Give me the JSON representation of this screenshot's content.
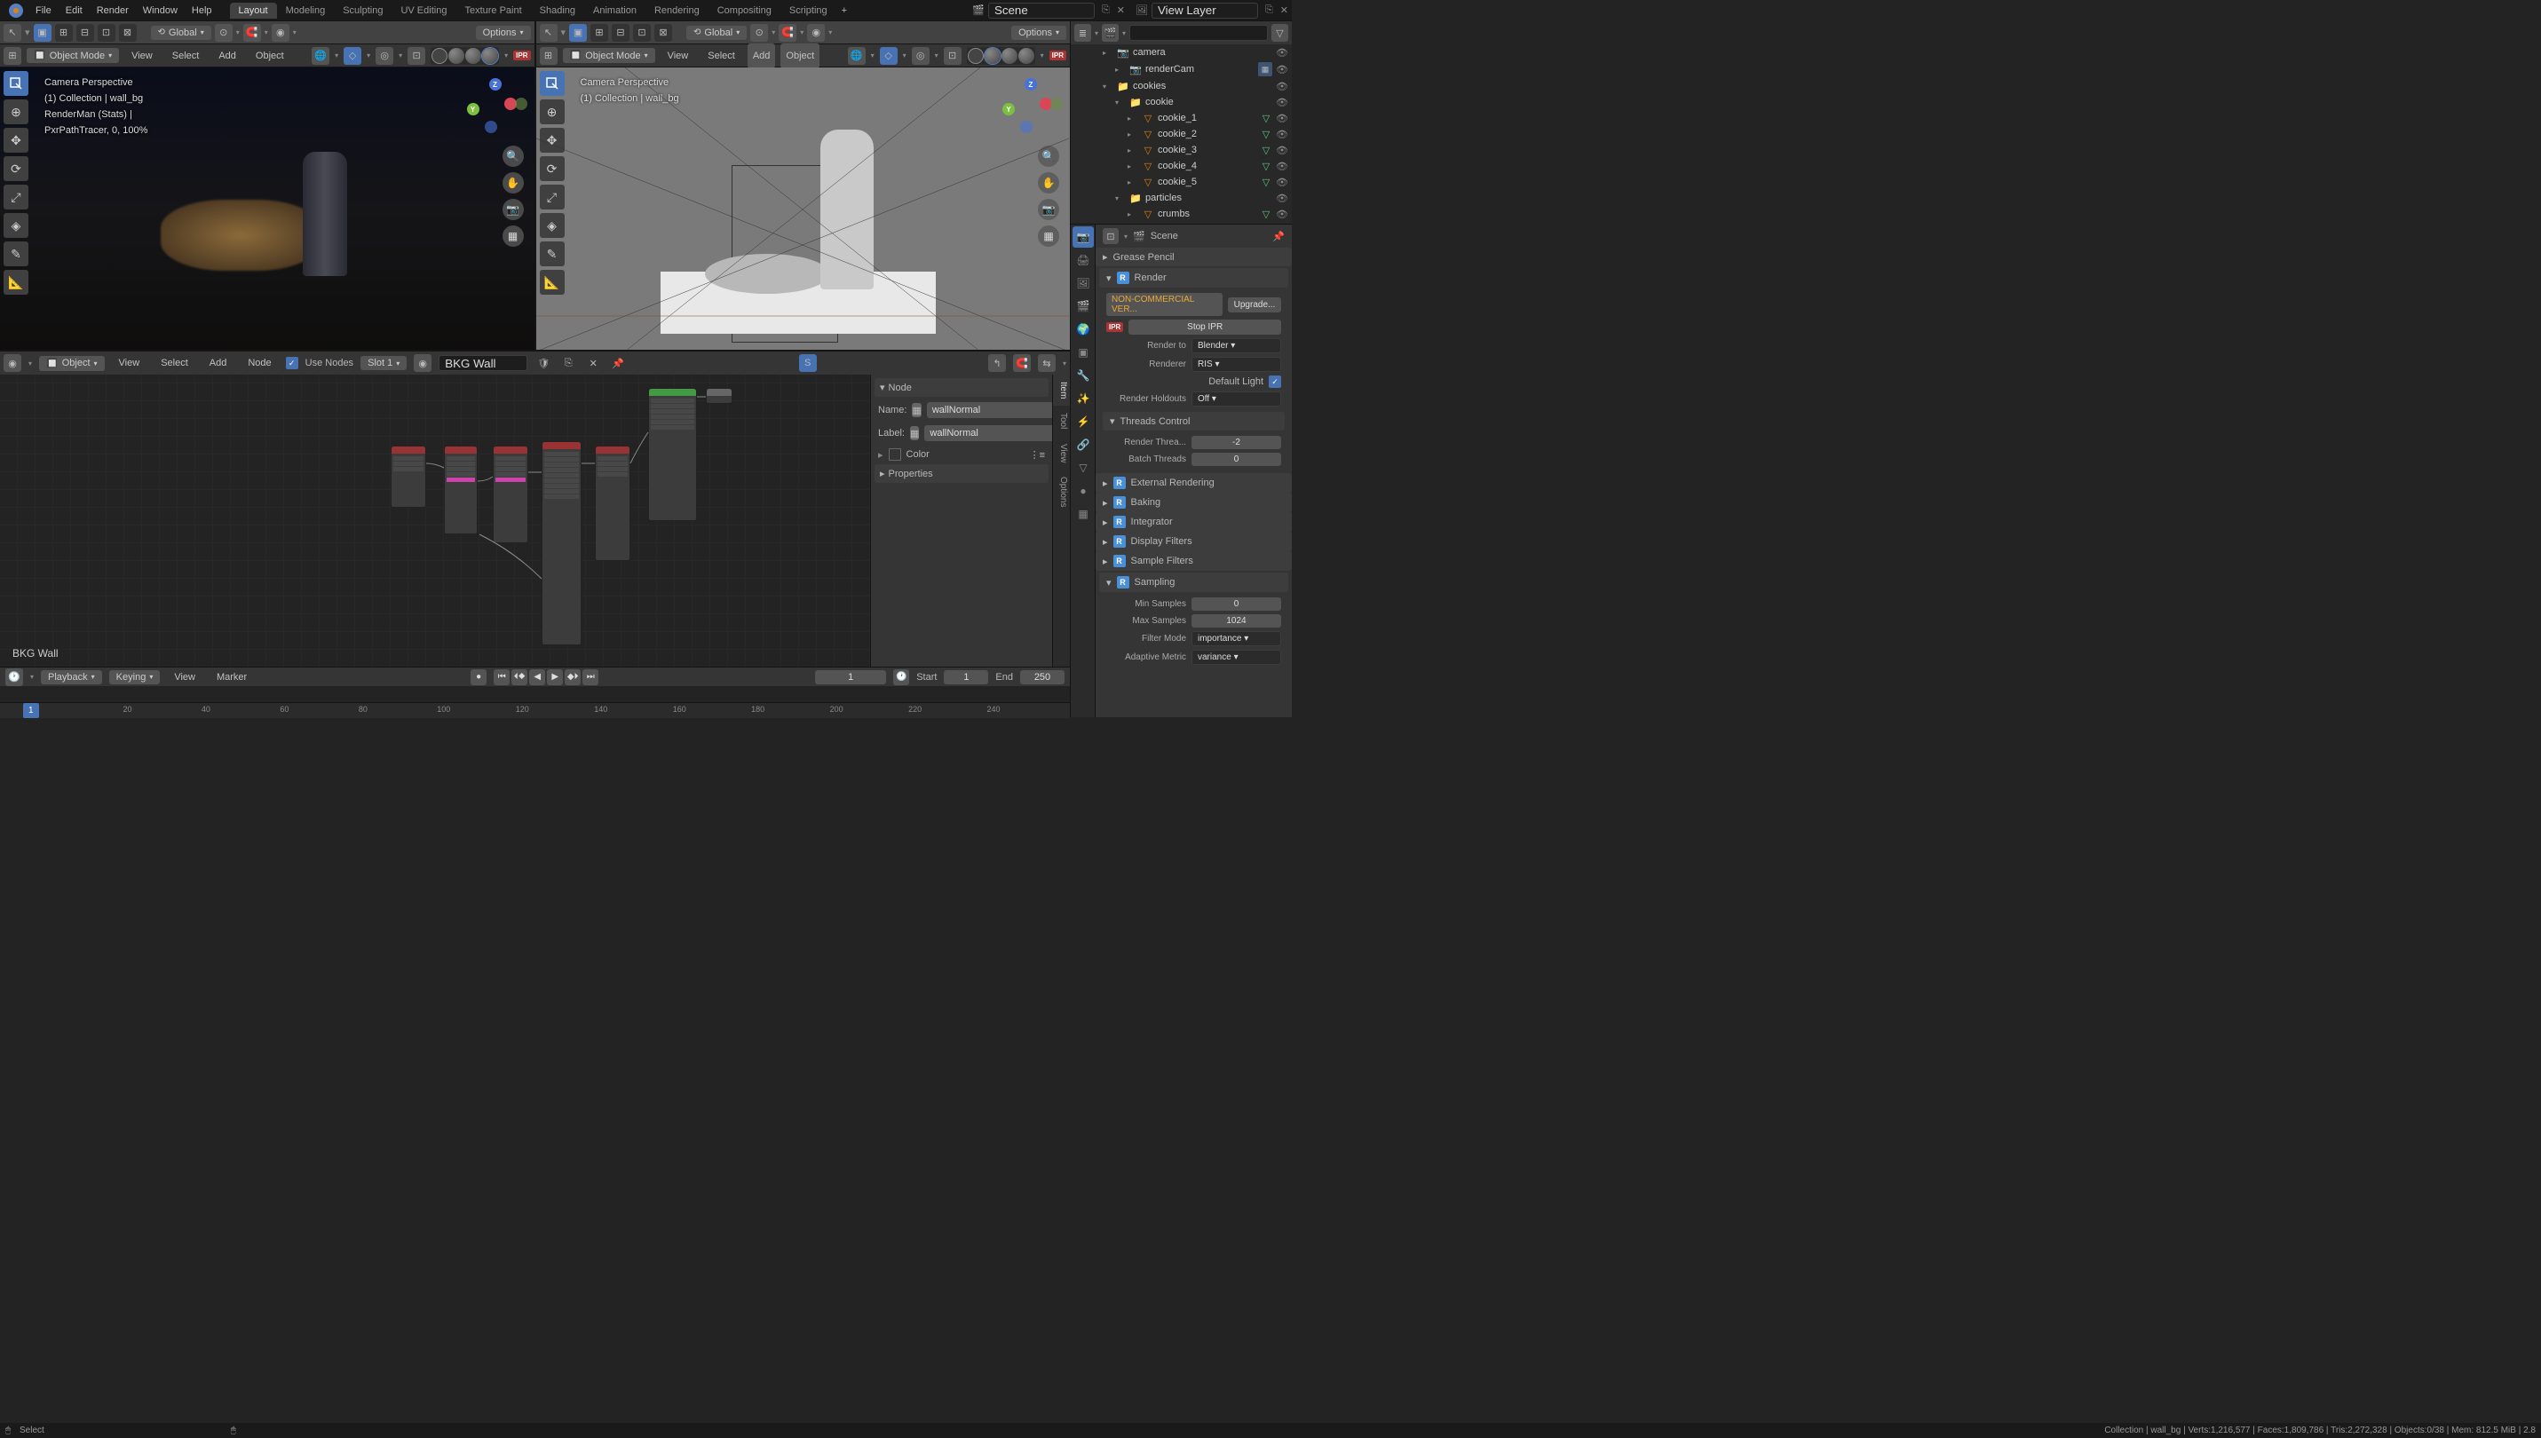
{
  "menu": {
    "file": "File",
    "edit": "Edit",
    "render": "Render",
    "window": "Window",
    "help": "Help"
  },
  "workspaces": [
    "Layout",
    "Modeling",
    "Sculpting",
    "UV Editing",
    "Texture Paint",
    "Shading",
    "Animation",
    "Rendering",
    "Compositing",
    "Scripting"
  ],
  "active_workspace": "Layout",
  "scene_name": "Scene",
  "view_layer": "View Layer",
  "viewport": {
    "header": {
      "orientation": "Global",
      "options_label": "Options"
    },
    "mode": "Object Mode",
    "menu_view": "View",
    "menu_select": "Select",
    "menu_add": "Add",
    "menu_object": "Object",
    "info_line1": "Camera Perspective",
    "info_line2": "(1) Collection | wall_bg",
    "info_line3": "RenderMan (Stats) |",
    "info_line4": "PxrPathTracer, 0, 100%"
  },
  "outliner_search_placeholder": "",
  "outliner": {
    "items": [
      {
        "indent": 2,
        "type": "camera",
        "label": "camera",
        "disclosure": "▸"
      },
      {
        "indent": 3,
        "type": "camera",
        "label": "renderCam",
        "disclosure": "▸",
        "restrict": true
      },
      {
        "indent": 2,
        "type": "collection",
        "label": "cookies",
        "disclosure": "▾"
      },
      {
        "indent": 3,
        "type": "collection",
        "label": "cookie",
        "disclosure": "▾"
      },
      {
        "indent": 4,
        "type": "mesh",
        "label": "cookie_1",
        "disclosure": "▸",
        "mesh_badge": true
      },
      {
        "indent": 4,
        "type": "mesh",
        "label": "cookie_2",
        "disclosure": "▸",
        "mesh_badge": true
      },
      {
        "indent": 4,
        "type": "mesh",
        "label": "cookie_3",
        "disclosure": "▸",
        "mesh_badge": true
      },
      {
        "indent": 4,
        "type": "mesh",
        "label": "cookie_4",
        "disclosure": "▸",
        "mesh_badge": true
      },
      {
        "indent": 4,
        "type": "mesh",
        "label": "cookie_5",
        "disclosure": "▸",
        "mesh_badge": true
      },
      {
        "indent": 3,
        "type": "collection",
        "label": "particles",
        "disclosure": "▾"
      },
      {
        "indent": 4,
        "type": "mesh",
        "label": "crumbs",
        "disclosure": "▸",
        "mesh_badge": true
      }
    ]
  },
  "node_editor": {
    "mode": "Object",
    "view": "View",
    "select": "Select",
    "add": "Add",
    "node": "Node",
    "use_nodes": "Use Nodes",
    "slot": "Slot 1",
    "material": "BKG Wall",
    "label_bl": "BKG Wall",
    "sidebar": {
      "hdr_node": "Node",
      "hdr_properties": "Properties",
      "name_label": "Name:",
      "name_value": "wallNormal",
      "label_label": "Label:",
      "label_value": "wallNormal",
      "color_label": "Color"
    },
    "tabs": [
      "Item",
      "Tool",
      "View",
      "Options"
    ]
  },
  "timeline": {
    "playback": "Playback",
    "keying": "Keying",
    "view": "View",
    "marker": "Marker",
    "current_frame": "1",
    "start_label": "Start",
    "start_value": "1",
    "end_label": "End",
    "end_value": "250",
    "ticks": [
      "20",
      "40",
      "60",
      "80",
      "100",
      "120",
      "140",
      "160",
      "180",
      "200",
      "220",
      "240"
    ]
  },
  "properties": {
    "breadcrumb": "Scene",
    "grease_pencil": "Grease Pencil",
    "render_hdr": "Render",
    "license_warn": "NON-COMMERCIAL VER...",
    "upgrade_btn": "Upgrade...",
    "stop_ipr": "Stop IPR",
    "render_to_label": "Render to",
    "render_to_value": "Blender",
    "renderer_label": "Renderer",
    "renderer_value": "RIS",
    "default_light_label": "Default Light",
    "render_holdouts_label": "Render Holdouts",
    "render_holdouts_value": "Off",
    "threads_hdr": "Threads Control",
    "render_threads_label": "Render Threa...",
    "render_threads_value": "-2",
    "batch_threads_label": "Batch Threads",
    "batch_threads_value": "0",
    "ext_rendering": "External Rendering",
    "baking": "Baking",
    "integrator": "Integrator",
    "display_filters": "Display Filters",
    "sample_filters": "Sample Filters",
    "sampling_hdr": "Sampling",
    "min_samples_label": "Min Samples",
    "min_samples_value": "0",
    "max_samples_label": "Max Samples",
    "max_samples_value": "1024",
    "filter_mode_label": "Filter Mode",
    "filter_mode_value": "importance",
    "adaptive_metric_label": "Adaptive Metric",
    "adaptive_metric_value": "variance"
  },
  "statusbar": {
    "left1": "Select",
    "right": "Collection | wall_bg | Verts:1,216,577 | Faces:1,809,786 | Tris:2,272,328 | Objects:0/38 | Mem: 812.5 MiB | 2.8"
  }
}
